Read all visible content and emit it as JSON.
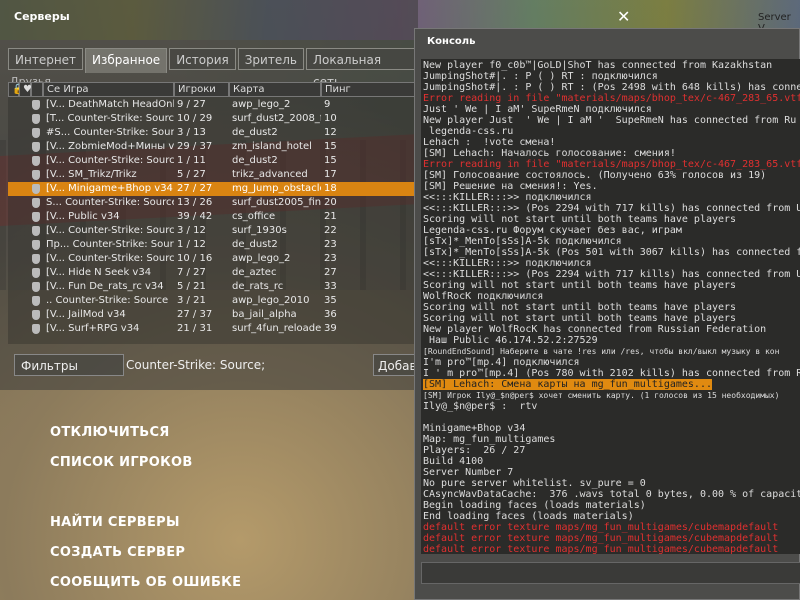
{
  "servers_window": {
    "title": "Серверы",
    "badge": "Server V",
    "tabs": [
      "Интернет",
      "Избранное",
      "История",
      "Зритель",
      "Локальная сеть"
    ],
    "active_tab": "Избранное",
    "hidden_tab_text": "Друзья",
    "columns": [
      "Игра",
      "Игроки",
      "Карта",
      "Пинг"
    ],
    "rows": [
      {
        "name": "[V... DeathMatch HeadOnly",
        "game": "",
        "players": "9 / 27",
        "map": "awp_lego_2",
        "ping": "9"
      },
      {
        "name": "[T... Counter-Strike: Source",
        "game": "",
        "players": "10 / 29",
        "map": "surf_dust2_2008_f...",
        "ping": "10"
      },
      {
        "name": "#S... Counter-Strike: Source",
        "game": "",
        "players": "3 / 13",
        "map": "de_dust2",
        "ping": "12"
      },
      {
        "name": "[V... ZobmieMod+Мины v34",
        "game": "",
        "players": "29 / 37",
        "map": "zm_island_hotel",
        "ping": "15"
      },
      {
        "name": "[V... Counter-Strike: Source",
        "game": "",
        "players": "1 / 11",
        "map": "de_dust2",
        "ping": "15"
      },
      {
        "name": "[V... SM_Trikz/Trikz",
        "game": "",
        "players": "5 / 27",
        "map": "trikz_advanced",
        "ping": "17"
      },
      {
        "name": "[V... Minigame+Bhop v34",
        "game": "",
        "players": "27 / 27",
        "map": "mg_Jump_obstacle...",
        "ping": "18"
      },
      {
        "name": "S... Counter-Strike: Source",
        "game": "",
        "players": "13 / 26",
        "map": "surf_dust2005_final",
        "ping": "20"
      },
      {
        "name": "[V... Public v34",
        "game": "",
        "players": "39 / 42",
        "map": "cs_office",
        "ping": "21"
      },
      {
        "name": "[V... Counter-Strike: Source",
        "game": "",
        "players": "3 / 12",
        "map": "surf_1930s",
        "ping": "22"
      },
      {
        "name": "Пр... Counter-Strike: Source",
        "game": "",
        "players": "1 / 12",
        "map": "de_dust2",
        "ping": "23"
      },
      {
        "name": "[V... Counter-Strike: Source",
        "game": "",
        "players": "10 / 16",
        "map": "awp_lego_2",
        "ping": "23"
      },
      {
        "name": "[V... Hide N Seek v34",
        "game": "",
        "players": "7 / 27",
        "map": "de_aztec",
        "ping": "27"
      },
      {
        "name": "[V... Fun De_rats_rc v34",
        "game": "",
        "players": "5 / 21",
        "map": "de_rats_rc",
        "ping": "33"
      },
      {
        "name": ".. Counter-Strike: Source",
        "game": "",
        "players": "3 / 21",
        "map": "awp_lego_2010",
        "ping": "35"
      },
      {
        "name": "[V... JailMod v34",
        "game": "",
        "players": "27 / 37",
        "map": "ba_jail_alpha",
        "ping": "36"
      },
      {
        "name": "[V... Surf+RPG v34",
        "game": "",
        "players": "21 / 31",
        "map": "surf_4fun_reloaded",
        "ping": "39"
      }
    ],
    "filters_label": "Фильтры",
    "filter_text": "Counter-Strike: Source;",
    "add_label": "Добав"
  },
  "main_menu": [
    "ОТКЛЮЧИТЬСЯ",
    "СПИСОК ИГРОКОВ",
    "НАЙТИ СЕРВЕРЫ",
    "СОЗДАТЬ СЕРВЕР",
    "СООБЩИТЬ ОБ ОШИБКЕ"
  ],
  "close_icon": "✕",
  "console": {
    "title": "Консоль",
    "lines": [
      {
        "text": "New player f0_c0b™|GoLD|ShoT has connected from Kazakhstan",
        "style": ""
      },
      {
        "text": "JumpingShot#|. : P ( ) RT : подключился",
        "style": ""
      },
      {
        "text": "JumpingShot#|. : P ( ) RT : (Pos 2498 with 648 kills) has conne",
        "style": ""
      },
      {
        "text": "Error reading in file \"materials/maps/bhop_tex/c-467_283_65.vtf",
        "style": "red"
      },
      {
        "text": "Just ' We | I aM' SupeRmeN подключился",
        "style": ""
      },
      {
        "text": "New player Just  ' We | I aM '  SupeRmeN has connected from Ru",
        "style": ""
      },
      {
        "text": " legenda-css.ru",
        "style": ""
      },
      {
        "text": "Lehach :  !vote смена!",
        "style": ""
      },
      {
        "text": "[SM] Lehach: Началось голосование: смения!",
        "style": ""
      },
      {
        "text": "Error reading in file \"materials/maps/bhop_tex/c-467_283_65.vtf",
        "style": "red"
      },
      {
        "text": "[SM] Голосование состоялось. (Получено 63% голосов из 19)",
        "style": ""
      },
      {
        "text": "[SM] Решение на смения!: Yes.",
        "style": ""
      },
      {
        "text": "<<:::KILLER:::>> подключился",
        "style": ""
      },
      {
        "text": "<<:::KILLER:::>> (Pos 2294 with 717 kills) has connected from U",
        "style": ""
      },
      {
        "text": "Scoring will not start until both teams have players",
        "style": ""
      },
      {
        "text": "Legenda-css.ru Форум скучает без вас, играм",
        "style": ""
      },
      {
        "text": "[sTx]*_MenTo[sSs]A-5k подключился",
        "style": ""
      },
      {
        "text": "[sTx]*_MenTo[sSs]A-5k (Pos 501 with 3067 kills) has connected fr",
        "style": ""
      },
      {
        "text": "<<:::KILLER:::>> подключился",
        "style": ""
      },
      {
        "text": "<<:::KILLER:::>> (Pos 2294 with 717 kills) has connected from U",
        "style": ""
      },
      {
        "text": "Scoring will not start until both teams have players",
        "style": ""
      },
      {
        "text": "WolfRocK подключился",
        "style": ""
      },
      {
        "text": "Scoring will not start until both teams have players",
        "style": ""
      },
      {
        "text": "Scoring will not start until both teams have players",
        "style": ""
      },
      {
        "text": "New player WolfRocK has connected from Russian Federation",
        "style": ""
      },
      {
        "text": " Наш Public 46.174.52.2:27529",
        "style": ""
      },
      {
        "text": "[RoundEndSound] Наберите в чате !res или /res, чтобы вкл/выкл музыку в кон",
        "style": "small"
      },
      {
        "text": "I'm pro™[mp.4] подключился",
        "style": ""
      },
      {
        "text": "I ' m pro™[mp.4] (Pos 780 with 2102 kills) has connected from R",
        "style": ""
      },
      {
        "text": "[SM] Lehach: Смена карты на mg_fun_multigames...",
        "style": "hl"
      },
      {
        "text": "[SM] Игрок Ily@_$n@per$ хочет сменить карту. (1 голосов из 15 необходимых)",
        "style": "small"
      },
      {
        "text": "Ily@_$n@per$ :  rtv",
        "style": ""
      },
      {
        "text": "",
        "style": ""
      },
      {
        "text": "Minigame+Bhop v34",
        "style": ""
      },
      {
        "text": "Map: mg_fun_multigames",
        "style": ""
      },
      {
        "text": "Players:  26 / 27",
        "style": ""
      },
      {
        "text": "Build 4100",
        "style": ""
      },
      {
        "text": "Server Number 7",
        "style": ""
      },
      {
        "text": "No pure server whitelist. sv_pure = 0",
        "style": ""
      },
      {
        "text": "CAsyncWavDataCache:  376 .wavs total 0 bytes, 0.00 % of capacit",
        "style": ""
      },
      {
        "text": "Begin loading faces (loads materials)",
        "style": ""
      },
      {
        "text": "End loading faces (loads materials)",
        "style": ""
      },
      {
        "text": "default error texture maps/mg_fun_multigames/cubemapdefault",
        "style": "red"
      },
      {
        "text": "default error texture maps/mg_fun_multigames/cubemapdefault",
        "style": "red"
      },
      {
        "text": "default error texture maps/mg_fun_multigames/cubemapdefault",
        "style": "red"
      }
    ],
    "input_value": ""
  }
}
